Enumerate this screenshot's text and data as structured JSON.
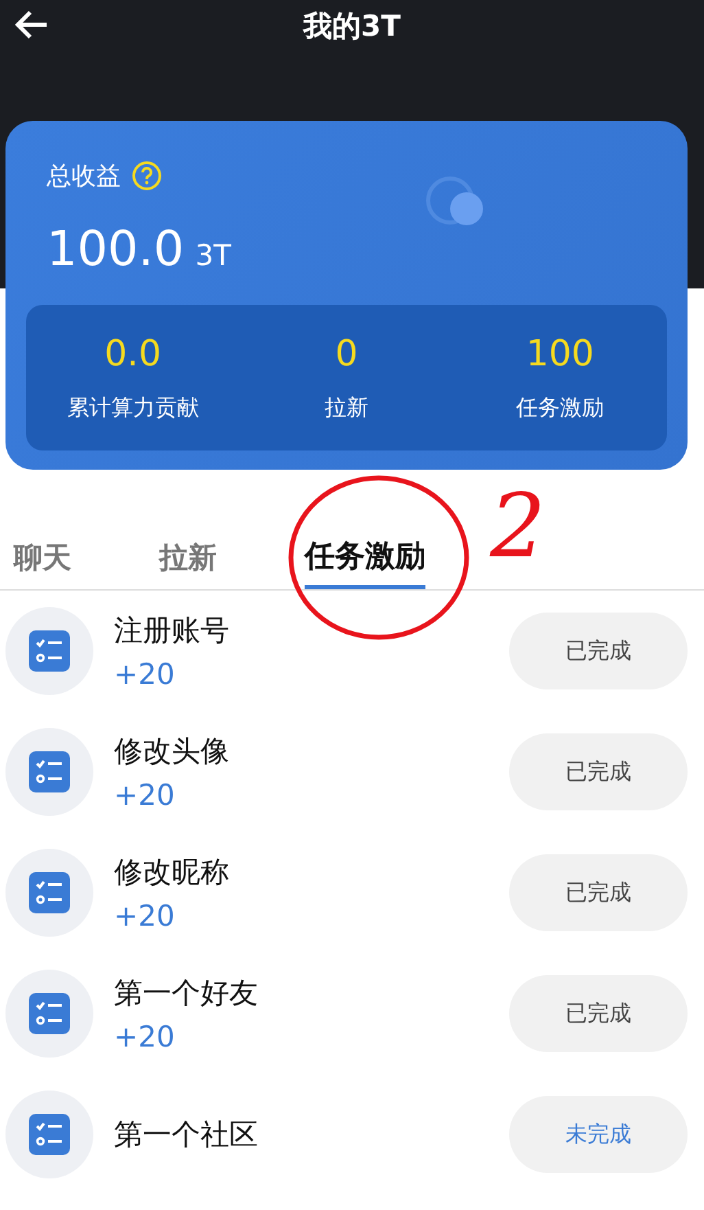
{
  "header": {
    "title": "我的3T"
  },
  "earnings": {
    "label": "总收益",
    "amount": "100.0",
    "unit": "3T",
    "stats": [
      {
        "value": "0.0",
        "label": "累计算力贡献"
      },
      {
        "value": "0",
        "label": "拉新"
      },
      {
        "value": "100",
        "label": "任务激励"
      }
    ]
  },
  "tabs": [
    {
      "label": "聊天",
      "selected": false
    },
    {
      "label": "拉新",
      "selected": false
    },
    {
      "label": "任务激励",
      "selected": true
    }
  ],
  "annotation": {
    "label": "2"
  },
  "tasks": [
    {
      "name": "注册账号",
      "reward": "+20",
      "status": "已完成",
      "completed": true
    },
    {
      "name": "修改头像",
      "reward": "+20",
      "status": "已完成",
      "completed": true
    },
    {
      "name": "修改昵称",
      "reward": "+20",
      "status": "已完成",
      "completed": true
    },
    {
      "name": "第一个好友",
      "reward": "+20",
      "status": "已完成",
      "completed": true
    },
    {
      "name": "第一个社区",
      "status": "未完成",
      "completed": false
    }
  ]
}
